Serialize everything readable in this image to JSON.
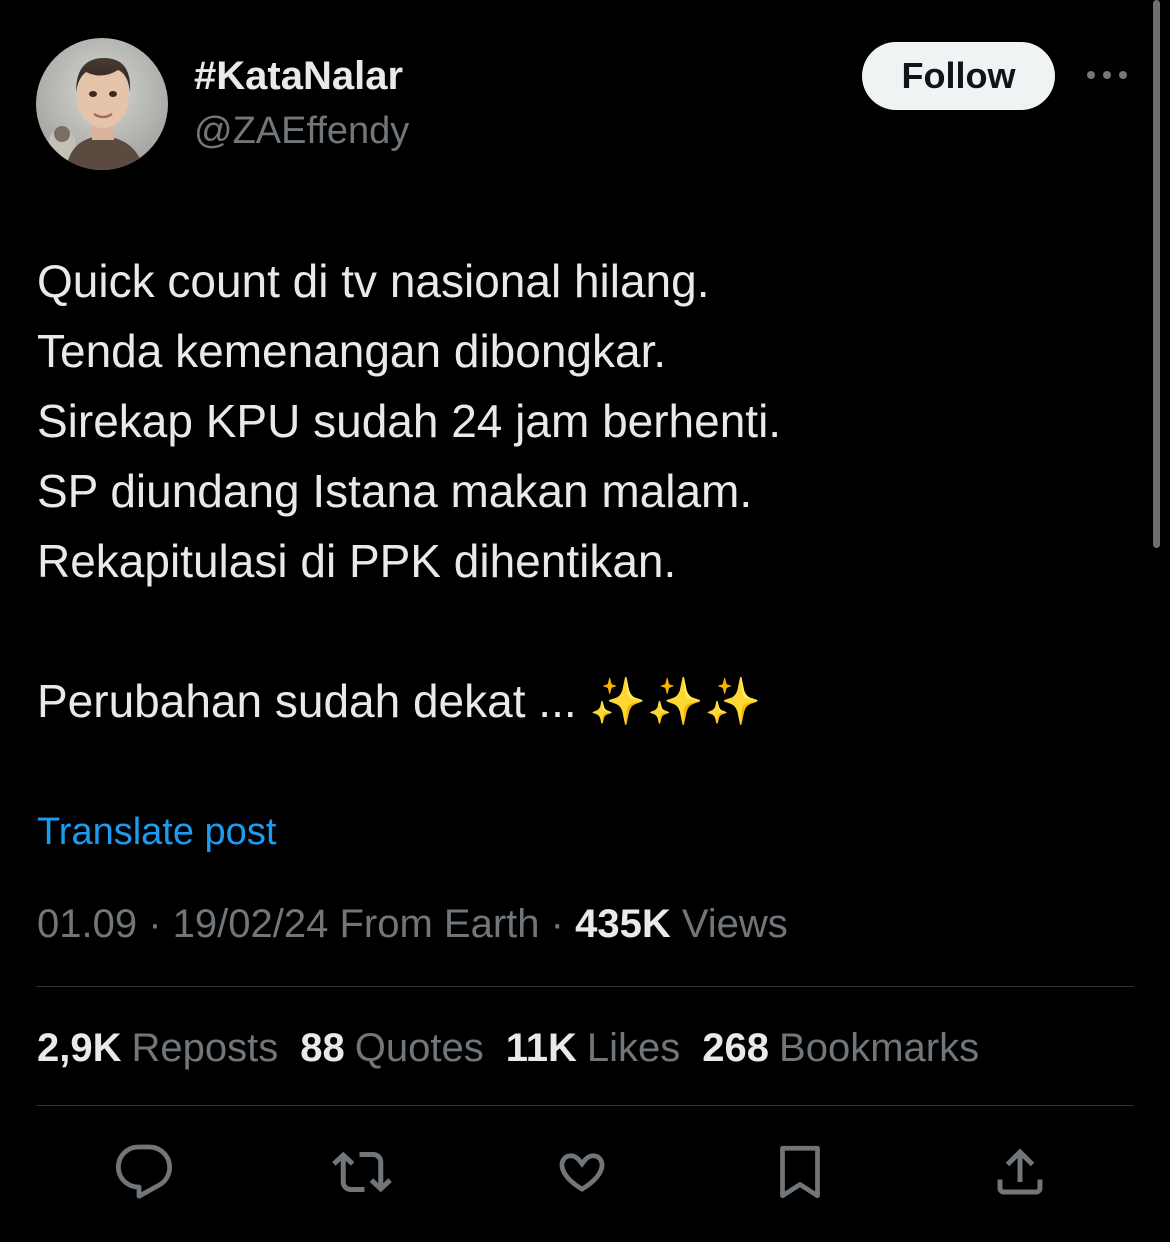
{
  "author": {
    "display_name": "#KataNalar",
    "handle": "@ZAEffendy"
  },
  "follow_label": "Follow",
  "tweet_lines": [
    "Quick count di tv nasional hilang.",
    "Tenda kemenangan dibongkar.",
    "Sirekap KPU sudah 24 jam berhenti.",
    "SP diundang Istana makan malam.",
    "Rekapitulasi di PPK dihentikan.",
    "",
    "Perubahan sudah dekat ... ✨✨✨"
  ],
  "translate_label": "Translate post",
  "meta": {
    "time": "01.09",
    "sep1": " · ",
    "date": "19/02/24",
    "source": "From Earth",
    "sep2": " · ",
    "views_count": "435K",
    "views_label": "Views"
  },
  "stats": [
    {
      "count": "2,9K",
      "label": "Reposts"
    },
    {
      "count": "88",
      "label": "Quotes"
    },
    {
      "count": "11K",
      "label": "Likes"
    },
    {
      "count": "268",
      "label": "Bookmarks"
    }
  ],
  "actions": [
    "reply-icon",
    "repost-icon",
    "like-icon",
    "bookmark-icon",
    "share-icon"
  ],
  "colors": {
    "background": "#000000",
    "text_primary": "#e7e9ea",
    "text_secondary": "#71767b",
    "link": "#1d9bf0",
    "follow_bg": "#eff3f4"
  }
}
